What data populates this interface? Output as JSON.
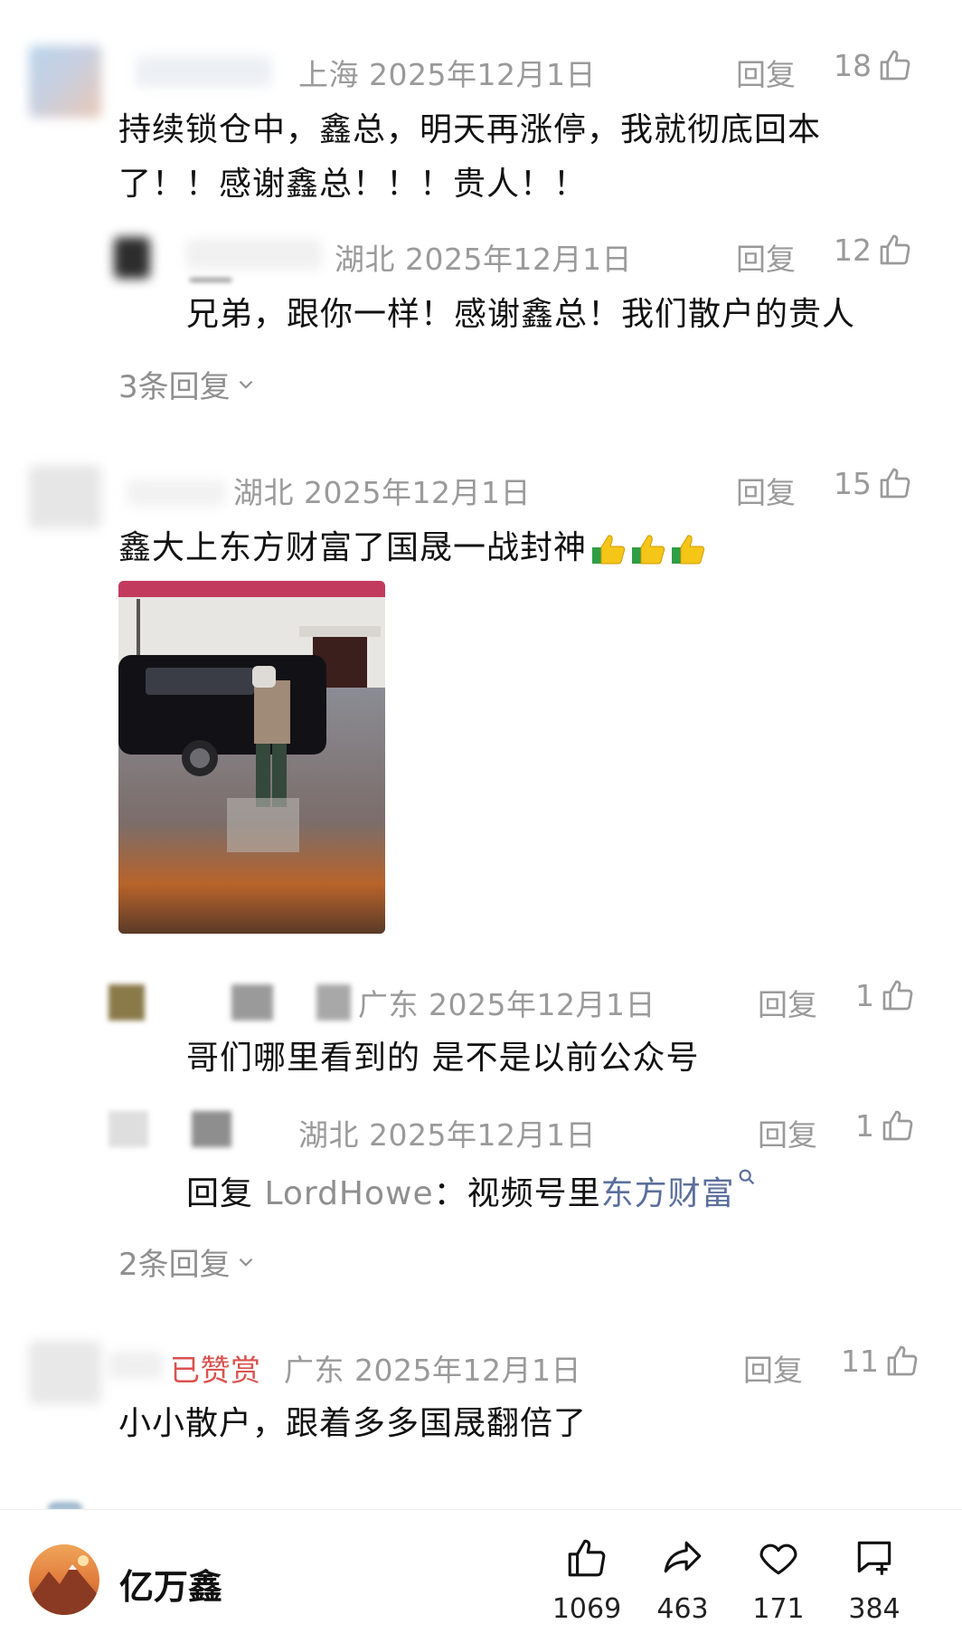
{
  "comments": [
    {
      "meta": "上海 2025年12月1日",
      "reply_label": "回复",
      "likes": "18",
      "text_line1": "持续锁仓中，鑫总，明天再涨停，我就彻底回本",
      "text_line2": "了！！感谢鑫总！！！贵人！！",
      "subreply": {
        "meta": "湖北 2025年12月1日",
        "reply_label": "回复",
        "likes": "12",
        "text": "兄弟，跟你一样！感谢鑫总！我们散户的贵人"
      },
      "more_replies": "3条回复"
    },
    {
      "meta": "湖北 2025年12月1日",
      "reply_label": "回复",
      "likes": "15",
      "text": "鑫大上东方财富了国晟一战封神",
      "emoji": "thumbs-up-icon",
      "subreplies": [
        {
          "meta": "广东 2025年12月1日",
          "reply_label": "回复",
          "likes": "1",
          "text": "哥们哪里看到的 是不是以前公众号"
        },
        {
          "meta": "湖北 2025年12月1日",
          "reply_label": "回复",
          "likes": "1",
          "text_prefix": "回复 ",
          "mention": "LordHowe",
          "text_mid": "：视频号里",
          "link": "东方财富"
        }
      ],
      "more_replies": "2条回复"
    },
    {
      "badge": "已赞赏",
      "meta": "广东 2025年12月1日",
      "reply_label": "回复",
      "likes": "11",
      "text": "小小散户，跟着多多国晟翻倍了"
    }
  ],
  "bottom_bar": {
    "author_name": "亿万鑫",
    "like_count": "1069",
    "share_count": "463",
    "favorite_count": "171",
    "comment_count": "384"
  },
  "colors": {
    "meta_gray": "#9a9a9a",
    "badge_red": "#d9534f",
    "link_blue": "#5b6f9c"
  }
}
